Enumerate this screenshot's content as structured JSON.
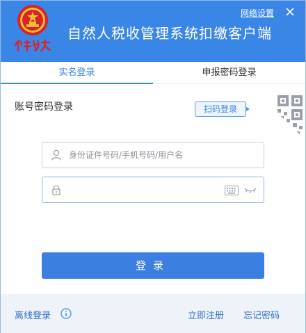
{
  "header": {
    "app_title": "自然人税收管理系统扣缴客户端",
    "network_settings": "网络设置",
    "logo_text": "中国税务"
  },
  "tabs": [
    {
      "label": "实名登录",
      "active": true
    },
    {
      "label": "申报密码登录",
      "active": false
    }
  ],
  "login": {
    "section_title": "账号密码登录",
    "scan_label": "扫码登录",
    "username_placeholder": "身份证件号码/手机号码/用户名",
    "username_value": "",
    "password_value": "",
    "submit_label": "登录"
  },
  "footer": {
    "offline_login": "离线登录",
    "register": "立即注册",
    "forgot_password": "忘记密码"
  },
  "colors": {
    "brand_blue": "#3a86e6",
    "button_blue": "#3b7fe0",
    "footer_bg": "#eef3fa"
  }
}
